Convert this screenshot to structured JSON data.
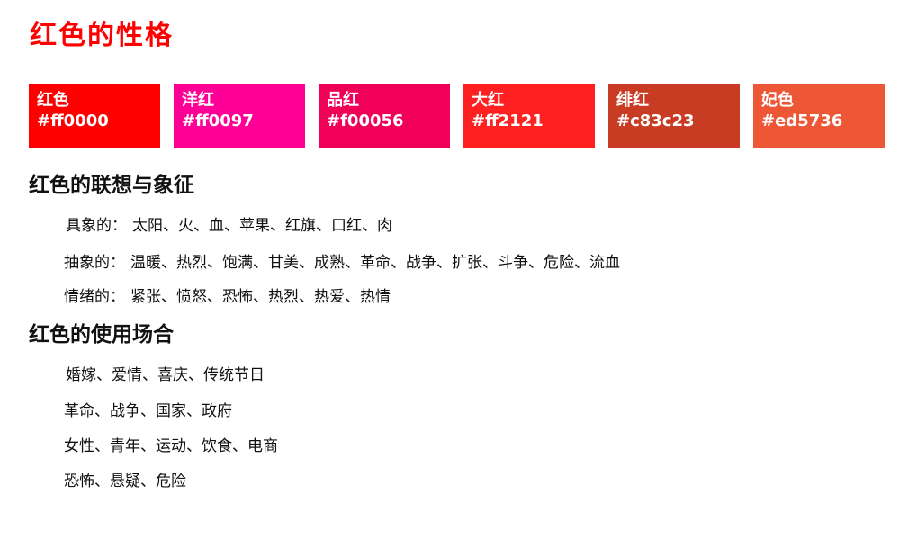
{
  "title": "红色的性格",
  "swatches": [
    {
      "name": "红色",
      "hex": "#ff0000",
      "color": "#ff0000"
    },
    {
      "name": "洋红",
      "hex": "#ff0097",
      "color": "#ff0097"
    },
    {
      "name": "品红",
      "hex": "#f00056",
      "color": "#f00056"
    },
    {
      "name": "大红",
      "hex": "#ff2121",
      "color": "#ff2121"
    },
    {
      "name": "绯红",
      "hex": "#c83c23",
      "color": "#c83c23"
    },
    {
      "name": "妃色",
      "hex": "#ed5736",
      "color": "#ed5736"
    }
  ],
  "associations": {
    "heading": "红色的联想与象征",
    "items": [
      {
        "label": "具象的：",
        "content": "太阳、火、血、苹果、红旗、口红、肉"
      },
      {
        "label": "抽象的：",
        "content": "温暖、热烈、饱满、甘美、成熟、革命、战争、扩张、斗争、危险、流血"
      },
      {
        "label": "情绪的：",
        "content": "紧张、愤怒、恐怖、热烈、热爱、热情"
      }
    ]
  },
  "usage": {
    "heading": "红色的使用场合",
    "items": [
      "婚嫁、爱情、喜庆、传统节日",
      "革命、战争、国家、政府",
      "女性、青年、运动、饮食、电商",
      "恐怖、悬疑、危险"
    ]
  }
}
